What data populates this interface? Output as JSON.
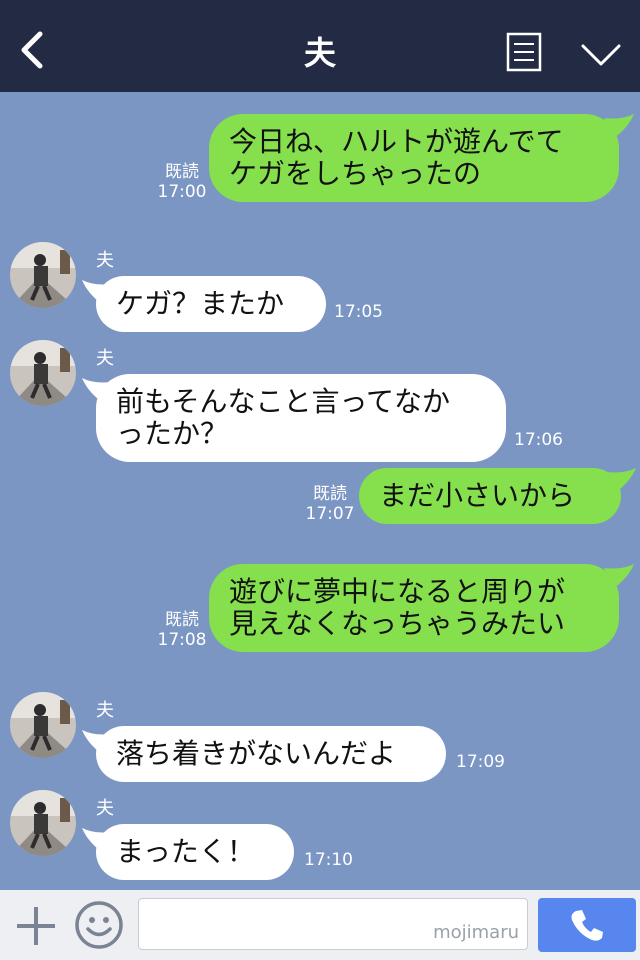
{
  "header": {
    "title": "夫",
    "back_icon": "chevron-left-icon",
    "notes_icon": "notes-icon",
    "menu_icon": "chevron-down-icon"
  },
  "colors": {
    "header_bg": "#232b44",
    "chat_bg": "#7b96c3",
    "my_bubble": "#86e04d",
    "their_bubble": "#ffffff",
    "send_button": "#5686ee"
  },
  "messages": [
    {
      "from": "me",
      "text": "今日ね、ハルトが遊んでて\nケガをしちゃったの",
      "read": "既読",
      "time": "17:00"
    },
    {
      "from": "them",
      "sender": "夫",
      "text": "ケガ？またか",
      "time": "17:05"
    },
    {
      "from": "them",
      "sender": "夫",
      "text": "前もそんなこと言ってなか\nったか？",
      "time": "17:06"
    },
    {
      "from": "me",
      "text": "まだ小さいから",
      "read": "既読",
      "time": "17:07"
    },
    {
      "from": "me",
      "text": "遊びに夢中になると周りが\n見えなくなっちゃうみたい",
      "read": "既読",
      "time": "17:08"
    },
    {
      "from": "them",
      "sender": "夫",
      "text": "落ち着きがないんだよ",
      "time": "17:09"
    },
    {
      "from": "them",
      "sender": "夫",
      "text": "まったく！",
      "time": "17:10"
    }
  ],
  "input": {
    "placeholder": "",
    "watermark": "mojimaru",
    "plus_icon": "plus-icon",
    "sticker_icon": "smiley-icon",
    "call_icon": "phone-icon"
  }
}
